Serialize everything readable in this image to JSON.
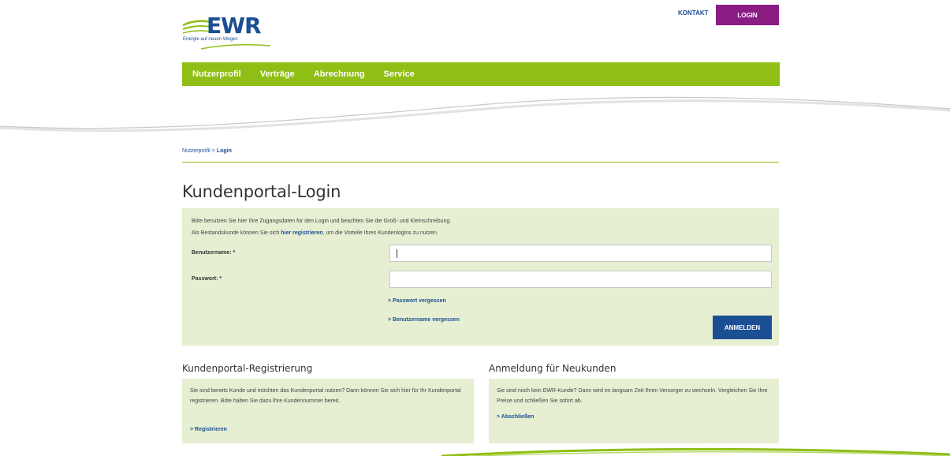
{
  "header": {
    "logo_text": "EWR",
    "logo_tagline": "Energie auf neuen Wegen",
    "contact_label": "KONTAKT",
    "login_label": "LOGIN"
  },
  "nav": {
    "items": [
      {
        "label": "Nutzerprofil"
      },
      {
        "label": "Verträge"
      },
      {
        "label": "Abrechnung"
      },
      {
        "label": "Service"
      }
    ]
  },
  "breadcrumb": {
    "parent": "Nutzerprofil",
    "separator": ">",
    "current": "Login"
  },
  "page_title": "Kundenportal-Login",
  "login": {
    "intro_line1": "Bitte benutzen Sie hier Ihre Zugangsdaten für den Login und beachten Sie die Groß- und Kleinschreibung.",
    "intro_line2_before": "Als Bestandskunde können Sie sich ",
    "intro_line2_link": "hier registrieren",
    "intro_line2_after": ", um die Vorteile Ihres Kundenlogins zu nutzen.",
    "username_label": "Benutzername: *",
    "username_value": "",
    "password_label": "Passwort: *",
    "password_value": "",
    "forgot_password": "> Passwort vergessen",
    "forgot_username": "> Benutzername vergessen",
    "submit_label": "ANMELDEN"
  },
  "registration": {
    "title": "Kundenportal-Registrierung",
    "text": "Sie sind bereits Kunde und möchten das Kundenportal nutzen? Dann können Sie sich hier für Ihr Kundenportal registrieren. Bitte halten Sie dazu Ihre Kundennummer bereit.",
    "link": "> Registrieren"
  },
  "new_customers": {
    "title": "Anmeldung für Neukunden",
    "text": "Sie sind noch kein EWR-Kunde? Dann wird es langsam Zeit Ihren Versorger zu wechseln. Vergleichen Sie Ihre Preise und schließen Sie sofort ab.",
    "link": "> Abschließen"
  },
  "colors": {
    "brand_blue": "#1b4f93",
    "brand_green": "#8fbe14",
    "login_purple": "#8b1c84",
    "panel_bg": "#e6efd1"
  }
}
